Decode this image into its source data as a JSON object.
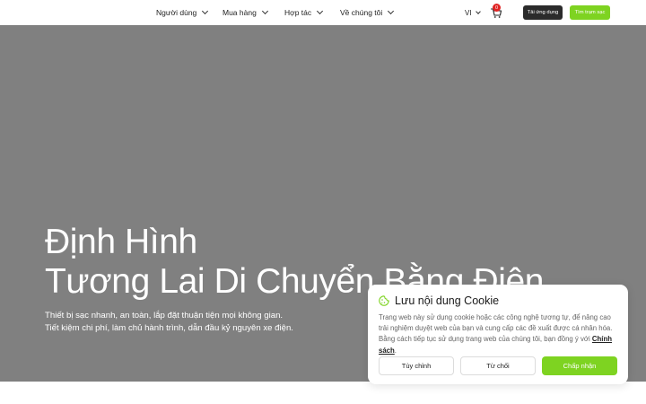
{
  "header": {
    "nav": [
      {
        "label": "Người dùng"
      },
      {
        "label": "Mua hàng"
      },
      {
        "label": "Hợp tác"
      },
      {
        "label": "Về chúng tôi"
      }
    ],
    "language": "VI",
    "cart_count": "0",
    "app_button": "Tải ứng dụng",
    "station_button": "Tìm trạm sạc"
  },
  "hero": {
    "title_line1": "Định Hình",
    "title_line2": "Tương Lai Di Chuyển Bằng Điện",
    "subtitle_line1": "Thiết bị sạc nhanh, an toàn, lắp đặt thuận tiện mọi không gian.",
    "subtitle_line2": "Tiết kiệm chi phí, làm chủ hành trình, dẫn đầu kỷ nguyên xe điện."
  },
  "cookie": {
    "title": "Lưu nội dung Cookie",
    "text": "Trang web này sử dụng cookie hoặc các công nghệ tương tự, để nâng cao trải nghiệm duyệt web của bạn và cung cấp các đề xuất được cá nhân hóa. Bằng cách tiếp tục sử dụng trang web của chúng tôi, bạn đồng ý với ",
    "policy_link": "Chính sách",
    "text_end": ".",
    "customize": "Tùy chỉnh",
    "reject": "Từ chối",
    "accept": "Chấp nhận"
  },
  "colors": {
    "accent": "#7ed321",
    "dark": "#2b2b2b",
    "hero_bg": "#808080",
    "badge": "#e02424"
  }
}
